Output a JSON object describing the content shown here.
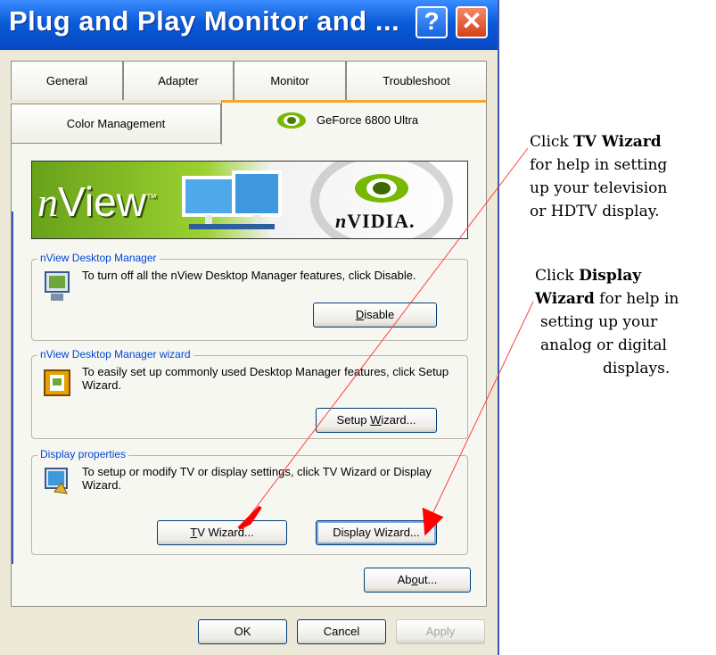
{
  "window": {
    "title": "Plug and Play Monitor and ...",
    "help_glyph": "?",
    "close_glyph": "✕"
  },
  "tabs": {
    "row1": [
      "General",
      "Adapter",
      "Monitor",
      "Troubleshoot"
    ],
    "row2": [
      "Color Management",
      "GeForce 6800 Ultra"
    ]
  },
  "banner": {
    "nview": "View",
    "nview_prefix": "n",
    "tm": "™",
    "nvidia_prefix": "n",
    "nvidia": "VIDIA."
  },
  "groups": {
    "desktop_manager": {
      "title": "nView Desktop Manager",
      "text": "To turn off all the nView Desktop Manager features, click Disable.",
      "button": "Disable",
      "button_mnemonic": "D",
      "button_rest": "isable"
    },
    "wizard": {
      "title": "nView Desktop Manager wizard",
      "text": "To easily set up commonly used Desktop Manager features, click Setup Wizard.",
      "button_pre": "Setup ",
      "button_mnemonic": "W",
      "button_post": "izard..."
    },
    "display": {
      "title": "Display properties",
      "text": "To setup or modify TV or display settings, click TV Wizard or Display Wizard.",
      "tv_mnemonic": "T",
      "tv_rest": "V Wizard...",
      "display_button": "Display Wizard..."
    }
  },
  "about_pre": "Ab",
  "about_mnemonic": "o",
  "about_post": "ut...",
  "footer": {
    "ok": "OK",
    "cancel": "Cancel",
    "apply": "Apply"
  },
  "annotations": {
    "tv": {
      "pre": "Click ",
      "bold": "TV Wizard",
      "lines": [
        "for help in setting",
        "up your television",
        "or HDTV display."
      ]
    },
    "display": {
      "pre": "Click ",
      "bold1": "Display",
      "bold2": "Wizard",
      "post2": " for help in",
      "lines": [
        "setting up your",
        "analog or digital",
        "displays."
      ]
    }
  },
  "colors": {
    "titlebar": "#0A5BD8",
    "dialog_bg": "#ECE9D8",
    "annotation_arrow": "#FF0000",
    "group_title": "#0046D5"
  }
}
